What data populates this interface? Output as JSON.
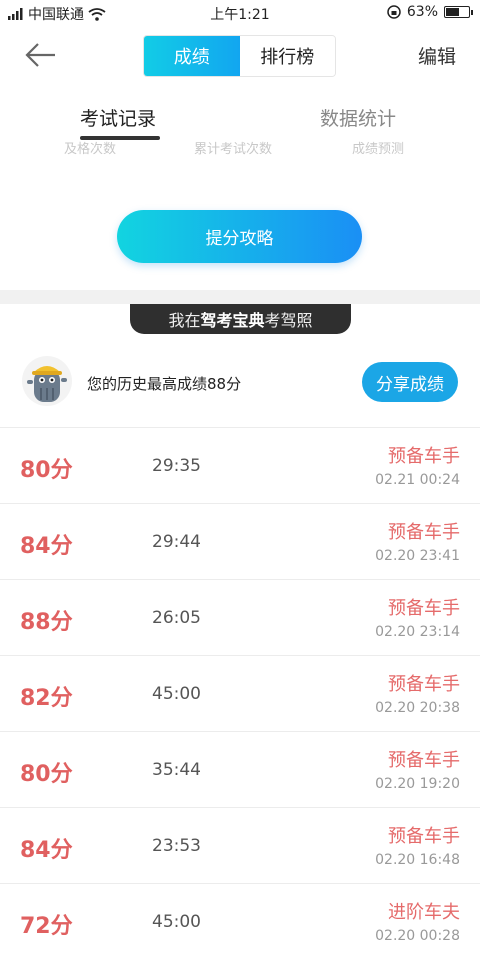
{
  "status_bar": {
    "carrier": "中国联通",
    "time": "上午1:21",
    "battery": "63%",
    "battery_level": 0.63
  },
  "header": {
    "tabs": [
      {
        "label": "成绩",
        "active": true
      },
      {
        "label": "排行榜",
        "active": false
      }
    ],
    "edit_label": "编辑"
  },
  "subtabs": [
    {
      "label": "考试记录",
      "active": true
    },
    {
      "label": "数据统计",
      "active": false
    }
  ],
  "stats_labels": [
    "及格次数",
    "累计考试次数",
    "成绩预测"
  ],
  "boost_button": "提分攻略",
  "slogan": {
    "prefix": "我在",
    "brand": "驾考宝典",
    "suffix": "考驾照"
  },
  "best": {
    "text": "您的历史最高成绩88分",
    "share_label": "分享成绩"
  },
  "records": [
    {
      "score": "80分",
      "duration": "29:35",
      "level": "预备车手",
      "date": "02.21  00:24"
    },
    {
      "score": "84分",
      "duration": "29:44",
      "level": "预备车手",
      "date": "02.20  23:41"
    },
    {
      "score": "88分",
      "duration": "26:05",
      "level": "预备车手",
      "date": "02.20  23:14"
    },
    {
      "score": "82分",
      "duration": "45:00",
      "level": "预备车手",
      "date": "02.20  20:38"
    },
    {
      "score": "80分",
      "duration": "35:44",
      "level": "预备车手",
      "date": "02.20  19:20"
    },
    {
      "score": "84分",
      "duration": "23:53",
      "level": "预备车手",
      "date": "02.20  16:48"
    },
    {
      "score": "72分",
      "duration": "45:00",
      "level": "进阶车夫",
      "date": "02.20  00:28"
    }
  ],
  "colors": {
    "accent": "#12a6f0",
    "score": "#e06060",
    "level": "#e56b6b"
  }
}
